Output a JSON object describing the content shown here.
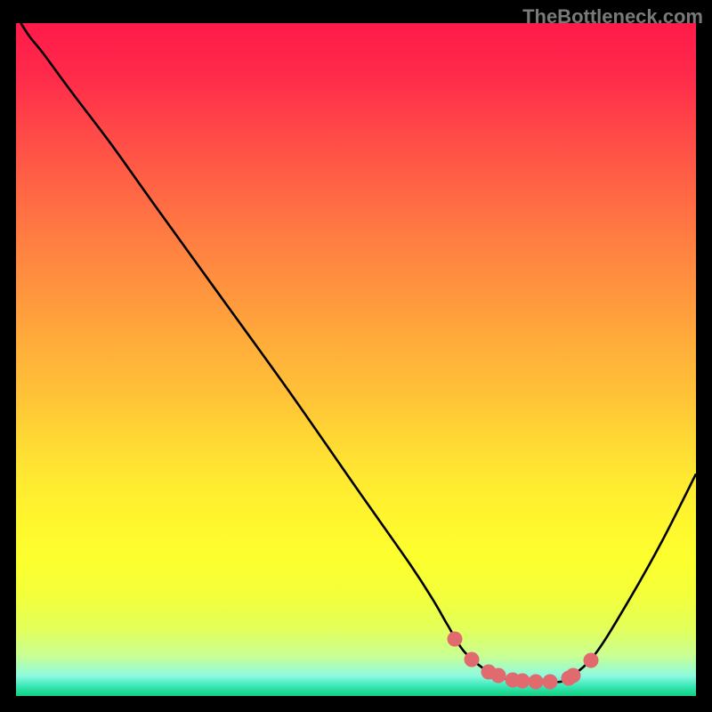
{
  "watermark": "TheBottleneck.com",
  "chart_data": {
    "type": "line",
    "title": "",
    "xlabel": "",
    "ylabel": "",
    "xlim": [
      0,
      100
    ],
    "ylim": [
      0,
      100
    ],
    "curve": {
      "x": [
        0.7,
        2,
        4,
        8,
        14,
        20,
        30,
        40,
        50,
        58,
        61.5,
        63.5,
        66,
        70,
        74,
        77,
        79,
        81,
        85,
        90,
        95,
        100
      ],
      "y": [
        100,
        98,
        95.5,
        90,
        82,
        73.5,
        59.5,
        45.5,
        31,
        19.5,
        14,
        10.5,
        6.5,
        3.3,
        2.2,
        2.1,
        2.1,
        2.5,
        6,
        14,
        23,
        33
      ]
    },
    "markers": [
      {
        "x": 64.5,
        "y": 8.5
      },
      {
        "x": 67.0,
        "y": 5.4
      },
      {
        "x": 69.5,
        "y": 3.6
      },
      {
        "x": 71.0,
        "y": 3.0
      },
      {
        "x": 73.0,
        "y": 2.4
      },
      {
        "x": 74.5,
        "y": 2.2
      },
      {
        "x": 76.5,
        "y": 2.1
      },
      {
        "x": 78.5,
        "y": 2.1
      },
      {
        "x": 81.3,
        "y": 2.6
      },
      {
        "x": 82.0,
        "y": 3.0
      },
      {
        "x": 84.5,
        "y": 5.3
      }
    ],
    "gradient_colors": {
      "top": "#ff1a4a",
      "mid": "#ffea31",
      "bottom": "#16ce86"
    }
  }
}
